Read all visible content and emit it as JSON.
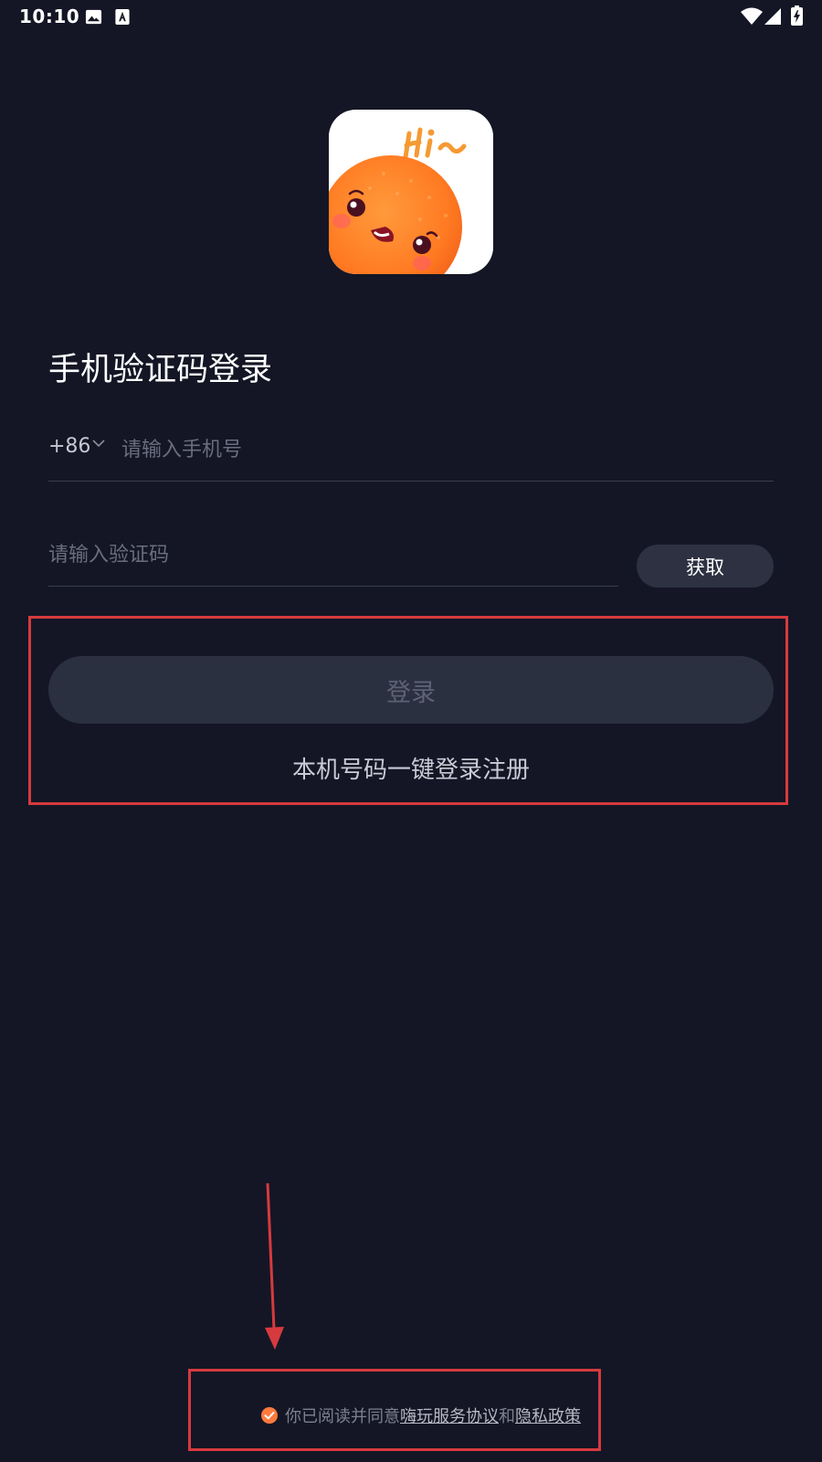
{
  "status_bar": {
    "time": "10:10"
  },
  "login": {
    "title": "手机验证码登录",
    "country_code": "+86",
    "phone_placeholder": "请输入手机号",
    "code_placeholder": "请输入验证码",
    "get_code_label": "获取",
    "login_button_label": "登录",
    "one_click_label": "本机号码一键登录注册"
  },
  "agreement": {
    "prefix": "你已阅读并同意",
    "service_link": "嗨玩服务协议",
    "and": "和",
    "privacy_link": "隐私政策"
  },
  "colors": {
    "background": "#141625",
    "accent": "#ff7a3d",
    "annotation": "#d63a3e"
  },
  "icons": {
    "gallery": "image-icon",
    "text_notification": "text-a-icon",
    "wifi": "wifi-icon",
    "signal": "signal-icon",
    "battery": "battery-charging-icon",
    "check": "check-circle-icon",
    "chevron": "chevron-down-icon"
  }
}
